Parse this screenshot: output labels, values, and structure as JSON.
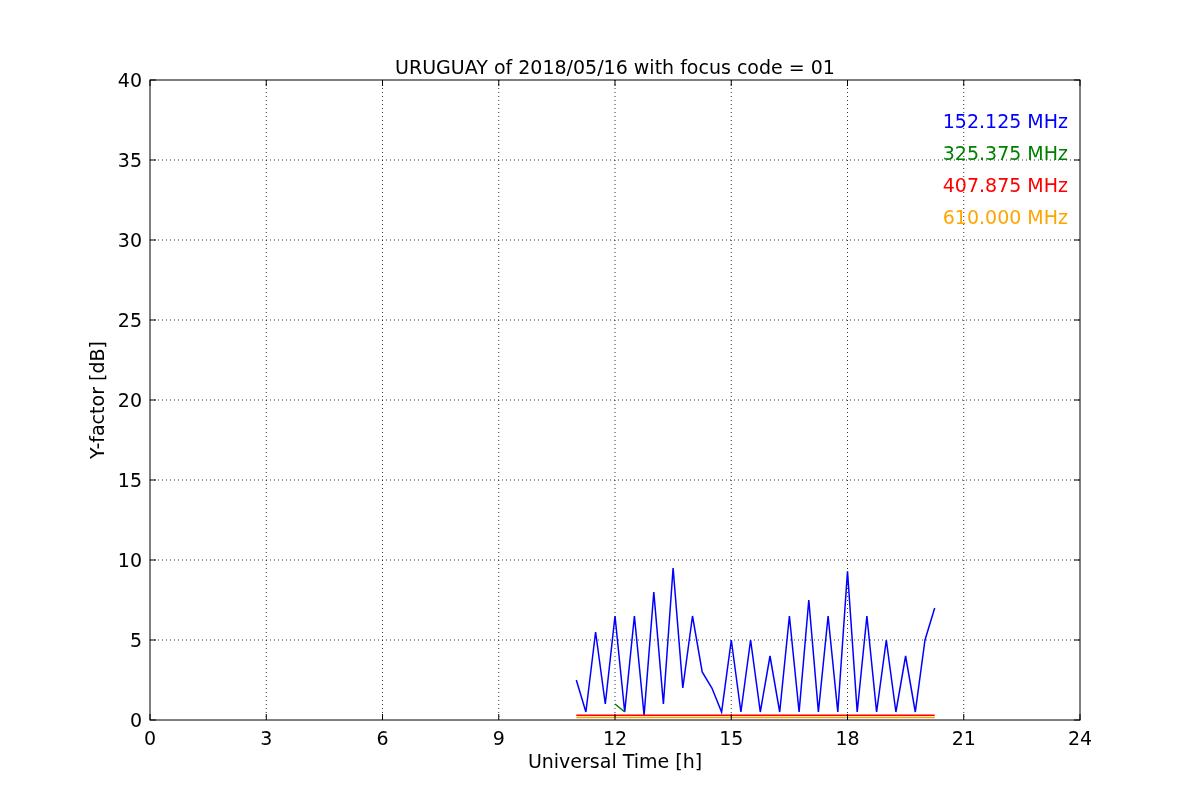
{
  "chart_data": {
    "type": "line",
    "title": "URUGUAY of 2018/05/16 with focus code = 01",
    "xlabel": "Universal Time [h]",
    "ylabel": "Y-factor [dB]",
    "xlim": [
      0,
      24
    ],
    "ylim": [
      0,
      40
    ],
    "xticks": [
      0,
      3,
      6,
      9,
      12,
      15,
      18,
      21,
      24
    ],
    "yticks": [
      0,
      5,
      10,
      15,
      20,
      25,
      30,
      35,
      40
    ],
    "grid": true,
    "x": [
      11.0,
      11.25,
      11.5,
      11.75,
      12.0,
      12.25,
      12.5,
      12.75,
      13.0,
      13.25,
      13.5,
      13.75,
      14.0,
      14.25,
      14.5,
      14.75,
      15.0,
      15.25,
      15.5,
      15.75,
      16.0,
      16.25,
      16.5,
      16.75,
      17.0,
      17.25,
      17.5,
      17.75,
      18.0,
      18.25,
      18.5,
      18.75,
      19.0,
      19.25,
      19.5,
      19.75,
      20.0,
      20.25
    ],
    "series": [
      {
        "name": "152.125 MHz",
        "color": "#0000ff",
        "values": [
          2.5,
          0.5,
          5.5,
          1.0,
          6.5,
          0.5,
          6.5,
          0.3,
          8.0,
          1.0,
          9.5,
          2.0,
          6.5,
          3.0,
          2.0,
          0.5,
          5.0,
          0.5,
          5.0,
          0.5,
          4.0,
          0.5,
          6.5,
          0.5,
          7.5,
          0.5,
          6.5,
          0.5,
          9.3,
          0.5,
          6.5,
          0.5,
          5.0,
          0.5,
          4.0,
          0.5,
          5.0,
          7.0
        ]
      },
      {
        "name": "325.375 MHz",
        "color": "#008000",
        "values": [
          null,
          null,
          null,
          null,
          1.0,
          0.5,
          null,
          null,
          null,
          null,
          null,
          null,
          null,
          null,
          null,
          null,
          null,
          null,
          null,
          null,
          null,
          null,
          null,
          null,
          null,
          null,
          null,
          null,
          null,
          null,
          null,
          null,
          null,
          null,
          null,
          null,
          null,
          null
        ]
      },
      {
        "name": "407.875 MHz",
        "color": "#ff0000",
        "values": [
          0.3,
          0.3,
          0.3,
          0.3,
          0.3,
          0.3,
          0.3,
          0.3,
          0.3,
          0.3,
          0.3,
          0.3,
          0.3,
          0.3,
          0.3,
          0.3,
          0.3,
          0.3,
          0.3,
          0.3,
          0.3,
          0.3,
          0.3,
          0.3,
          0.3,
          0.3,
          0.3,
          0.3,
          0.3,
          0.3,
          0.3,
          0.3,
          0.3,
          0.3,
          0.3,
          0.3,
          0.3,
          0.3
        ]
      },
      {
        "name": "610.000 MHz",
        "color": "#ffa500",
        "values": [
          0.15,
          0.15,
          0.15,
          0.15,
          0.15,
          0.15,
          0.15,
          0.15,
          0.15,
          0.15,
          0.15,
          0.15,
          0.15,
          0.15,
          0.15,
          0.15,
          0.15,
          0.15,
          0.15,
          0.15,
          0.15,
          0.15,
          0.15,
          0.15,
          0.15,
          0.15,
          0.15,
          0.15,
          0.15,
          0.15,
          0.15,
          0.15,
          0.15,
          0.15,
          0.15,
          0.15,
          0.15,
          0.15
        ]
      }
    ]
  }
}
